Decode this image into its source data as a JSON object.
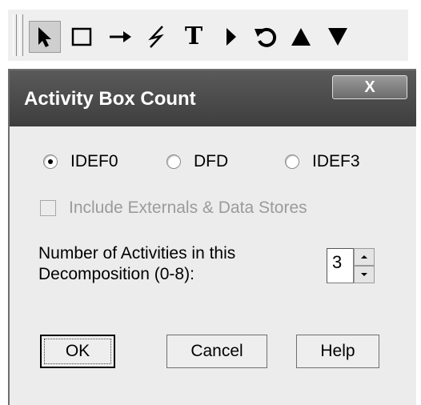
{
  "toolbar": {
    "tools": [
      {
        "icon": "pointer-icon"
      },
      {
        "icon": "rectangle-icon"
      },
      {
        "icon": "arrow-icon"
      },
      {
        "icon": "lightning-icon"
      },
      {
        "icon": "text-tool-icon",
        "glyph": "T"
      },
      {
        "icon": "triangle-right-icon"
      },
      {
        "icon": "rotate-icon"
      },
      {
        "icon": "triangle-up-icon"
      },
      {
        "icon": "triangle-down-icon"
      }
    ]
  },
  "dialog": {
    "title": "Activity Box Count",
    "close_label": "X",
    "methods": [
      {
        "label": "IDEF0",
        "checked": true
      },
      {
        "label": "DFD",
        "checked": false
      },
      {
        "label": "IDEF3",
        "checked": false
      }
    ],
    "include_externals_label": "Include Externals & Data Stores",
    "count_label_line1": "Number of Activities in this",
    "count_label_line2": "Decomposition (0-8):",
    "count_value": "3",
    "buttons": {
      "ok": "OK",
      "cancel": "Cancel",
      "help": "Help"
    }
  }
}
